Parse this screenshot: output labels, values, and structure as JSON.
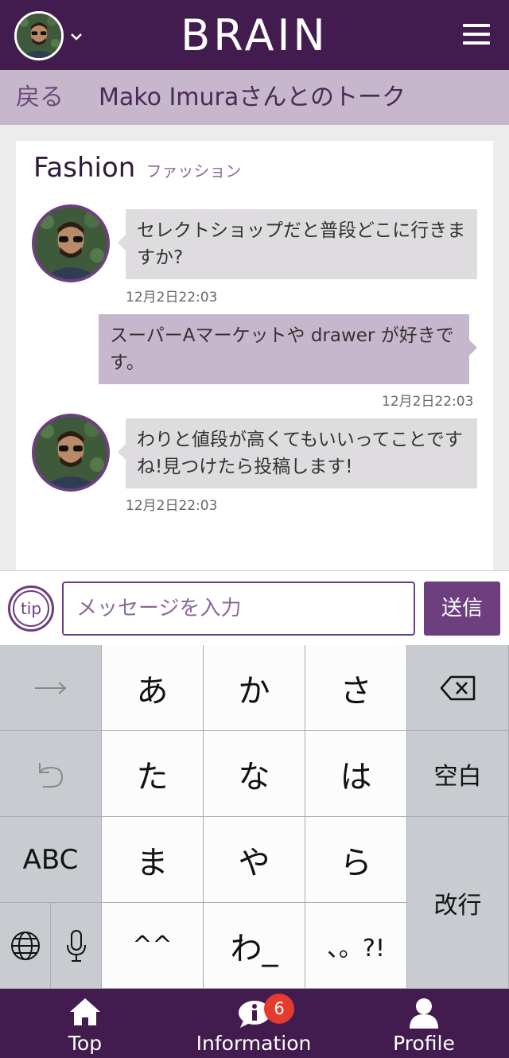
{
  "header": {
    "logo": "BRAIN",
    "avatar_icon": "user-avatar-icon",
    "menu_icon": "hamburger-menu-icon"
  },
  "subheader": {
    "back": "戻る",
    "title": "Mako Imuraさんとのトーク"
  },
  "topic": {
    "title": "Fashion",
    "subtitle": "ファッション"
  },
  "messages": [
    {
      "direction": "in",
      "text": "セレクトショップだと普段どこに行きますか?",
      "time": "12月2日22:03"
    },
    {
      "direction": "out",
      "text": "スーパーAマーケットや drawer が好きです。",
      "time": "12月2日22:03"
    },
    {
      "direction": "in",
      "text": "わりと値段が高くてもいいってことですね!見つけたら投稿します!",
      "time": "12月2日22:03"
    }
  ],
  "input": {
    "tip": "tip",
    "placeholder": "メッセージを入力",
    "value": "",
    "send": "送信"
  },
  "keyboard": {
    "row1": [
      "→",
      "あ",
      "か",
      "さ",
      "⌫"
    ],
    "row2": [
      "↶",
      "た",
      "な",
      "は",
      "空白"
    ],
    "row3": [
      "ABC",
      "ま",
      "や",
      "ら",
      "改行"
    ],
    "row4": [
      "🌐",
      "🎤",
      "^^",
      "わ_",
      "、。?!"
    ]
  },
  "nav": {
    "items": [
      {
        "label": "Top",
        "icon": "home-icon"
      },
      {
        "label": "Information",
        "icon": "info-bubble-icon",
        "badge": "6"
      },
      {
        "label": "Profile",
        "icon": "person-icon"
      }
    ]
  },
  "colors": {
    "brand": "#431c4f",
    "accent": "#6d3f7e",
    "light_purple": "#c7b7cc",
    "badge": "#e53b2c"
  }
}
